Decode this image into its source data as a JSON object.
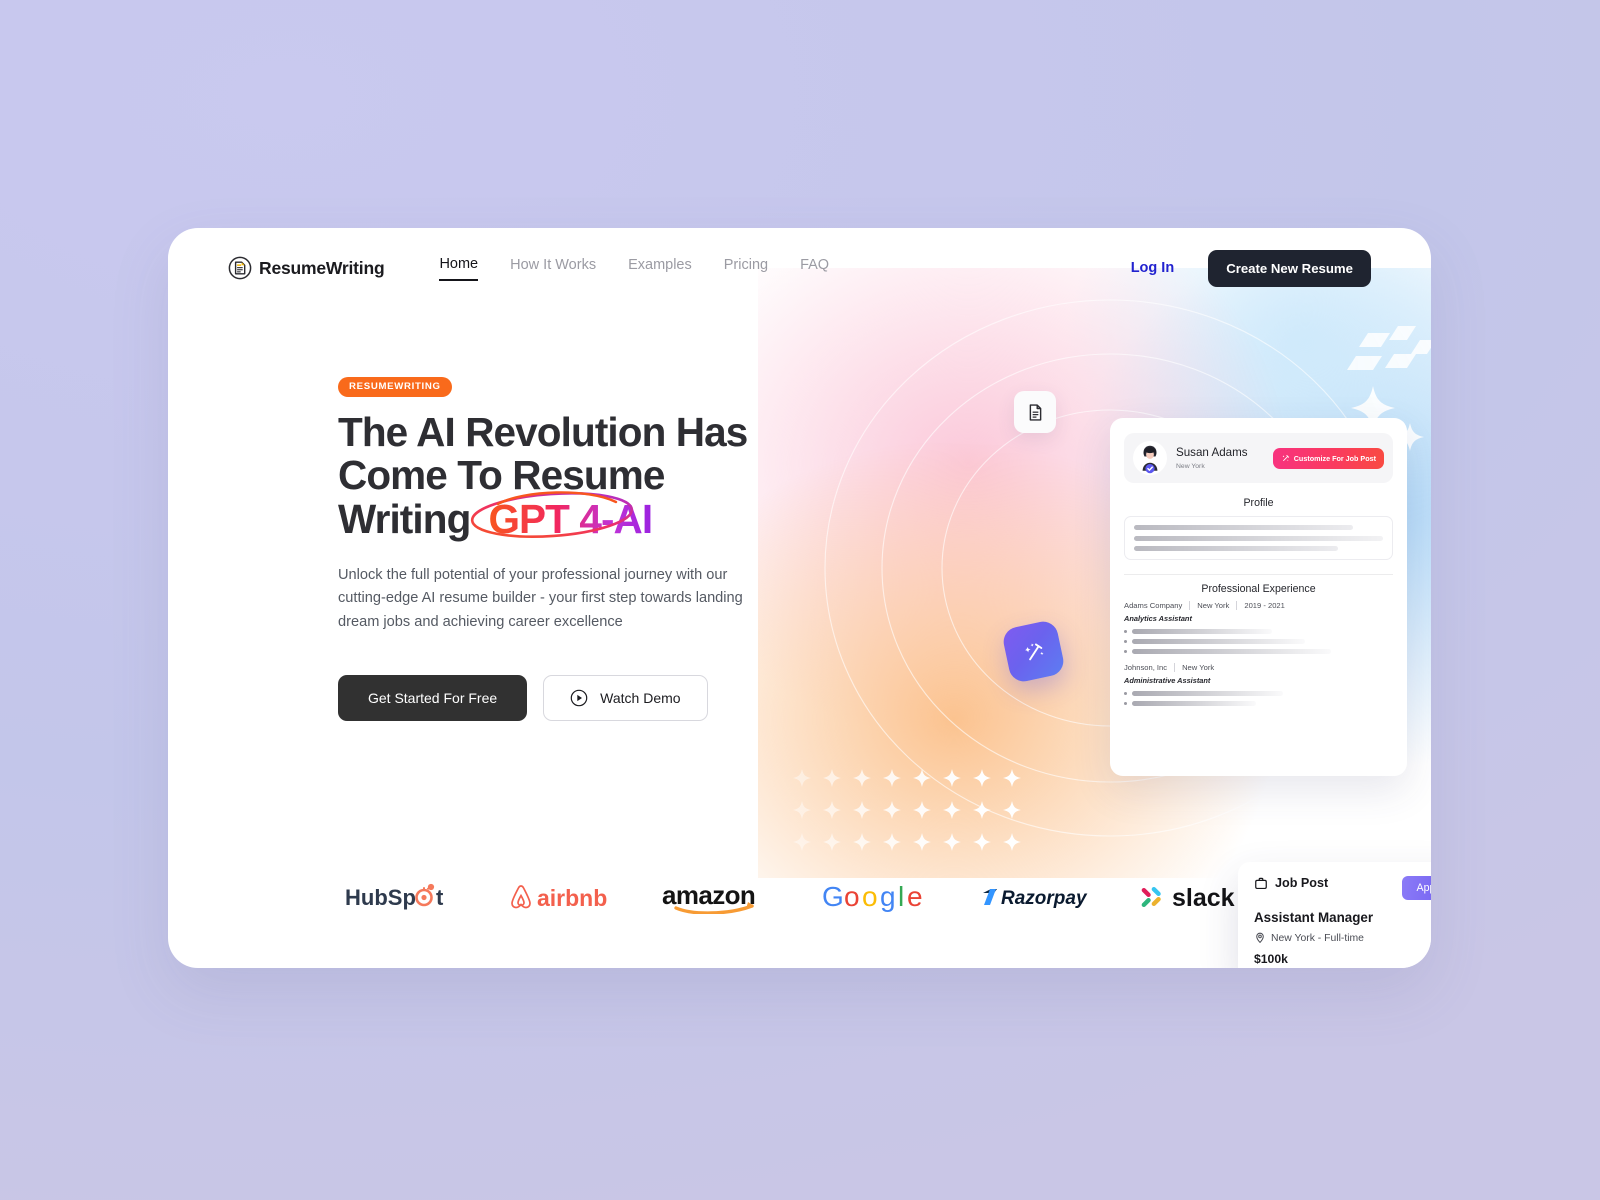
{
  "brand": {
    "name": "ResumeWriting",
    "icon": "document-badge-icon"
  },
  "nav": {
    "links": [
      {
        "label": "Home",
        "active": true
      },
      {
        "label": "How It Works",
        "active": false
      },
      {
        "label": "Examples",
        "active": false
      },
      {
        "label": "Pricing",
        "active": false
      },
      {
        "label": "FAQ",
        "active": false
      }
    ],
    "login_label": "Log In",
    "cta_label": "Create New Resume"
  },
  "hero": {
    "pill": "RESUMEWRITING",
    "headline_line1": "The AI Revolution Has",
    "headline_line2": "Come To Resume",
    "headline_line3": "Writing",
    "headline_highlight": "GPT 4-AI",
    "paragraph": "Unlock the full potential of your professional journey with our cutting-edge AI resume builder - your first step towards landing dream jobs and achieving career excellence",
    "primary_button": "Get Started For Free",
    "secondary_button": "Watch Demo",
    "accent_orange": "#f96a1b",
    "accent_blue": "#2222cf",
    "dark": "#1f2430"
  },
  "resume_card": {
    "person_name": "Susan Adams",
    "person_location": "New York",
    "customize_button": "Customize For Job Post",
    "profile_heading": "Profile",
    "experience_heading": "Professional Experience",
    "experience": [
      {
        "company": "Adams Company",
        "location": "New York",
        "dates": "2019 - 2021",
        "role": "Analytics Assistant",
        "bullet_count": 3
      },
      {
        "company": "Johnson, Inc",
        "location": "New York",
        "dates": "",
        "role": "Administrative Assistant",
        "bullet_count": 2
      }
    ]
  },
  "job_post": {
    "label": "Job Post",
    "apply_label": "Apply",
    "title": "Assistant Manager",
    "location": "New York - Full-time",
    "salary": "$100k"
  },
  "floating_icons": [
    {
      "name": "document-icon",
      "color": "#2c2c32"
    },
    {
      "name": "magic-wand-icon",
      "color": "#6b62ee"
    },
    {
      "name": "location-pin-icon",
      "color": "#f4821f"
    }
  ],
  "logos": [
    {
      "name": "hubspot-logo",
      "label": "HubSpot"
    },
    {
      "name": "airbnb-logo",
      "label": "airbnb"
    },
    {
      "name": "amazon-logo",
      "label": "amazon"
    },
    {
      "name": "google-logo",
      "label": "Google"
    },
    {
      "name": "razorpay-logo",
      "label": "Razorpay"
    },
    {
      "name": "slack-logo",
      "label": "slack"
    }
  ]
}
